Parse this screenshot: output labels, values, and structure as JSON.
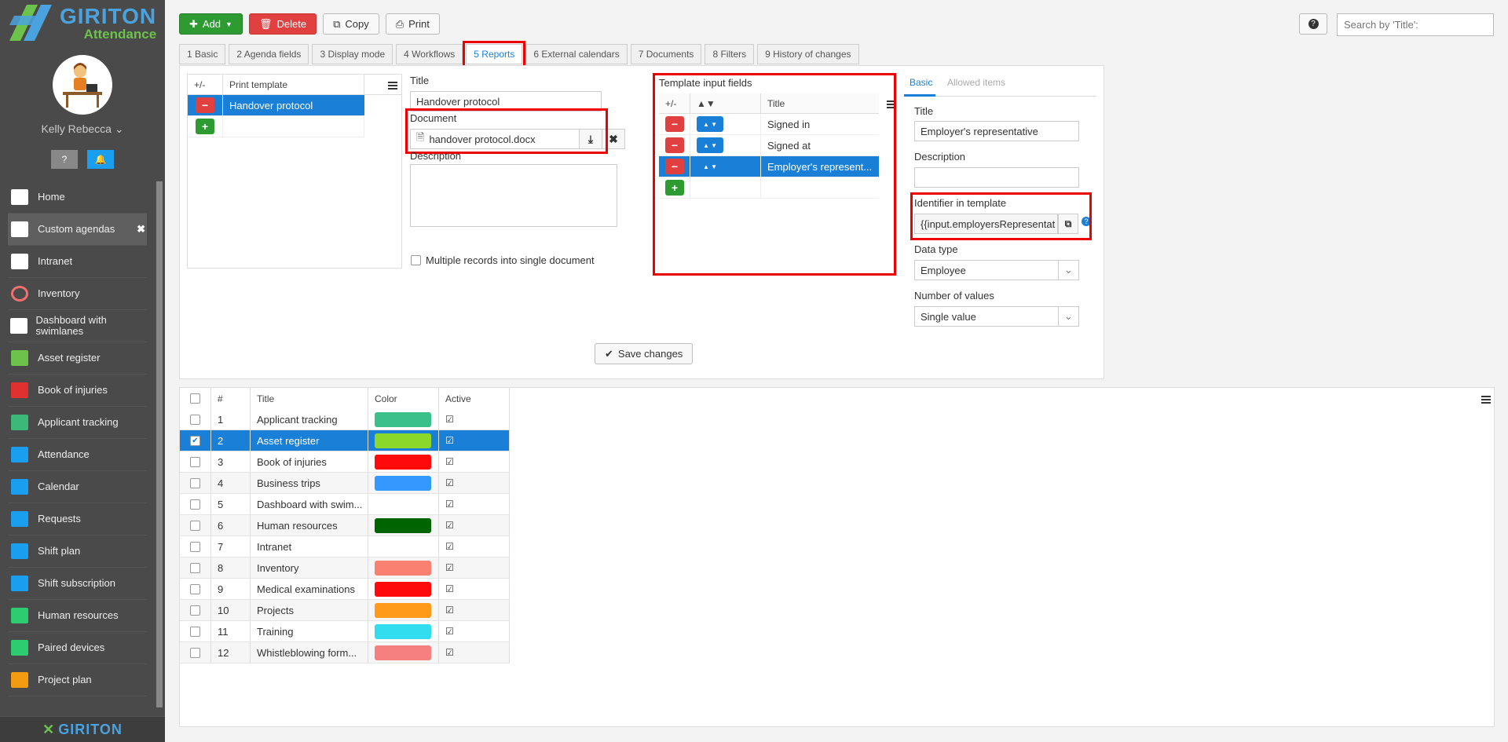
{
  "brand": {
    "name": "GIRITON",
    "product": "Attendance",
    "footer": "GIRITON"
  },
  "user": {
    "name": "Kelly Rebecca"
  },
  "sidebar": {
    "items": [
      {
        "label": "Home",
        "icon": "home-icon",
        "color": "#ffffff"
      },
      {
        "label": "Custom agendas",
        "icon": "list-icon",
        "color": "#ffffff",
        "active": true,
        "closable": "✖"
      },
      {
        "label": "Intranet",
        "icon": "institution-icon",
        "color": "#ffffff"
      },
      {
        "label": "Inventory",
        "icon": "circle-icon",
        "color": "#f07070"
      },
      {
        "label": "Dashboard with swimlanes",
        "icon": "columns-icon",
        "color": "#ffffff"
      },
      {
        "label": "Asset register",
        "icon": "archive-icon",
        "color": "#6cc24a"
      },
      {
        "label": "Book of injuries",
        "icon": "ambulance-icon",
        "color": "#e03030"
      },
      {
        "label": "Applicant tracking",
        "icon": "user-plus-icon",
        "color": "#3cb878"
      },
      {
        "label": "Attendance",
        "icon": "user-icon",
        "color": "#1a9ef0"
      },
      {
        "label": "Calendar",
        "icon": "calendar-icon",
        "color": "#1a9ef0"
      },
      {
        "label": "Requests",
        "icon": "gavel-icon",
        "color": "#1a9ef0"
      },
      {
        "label": "Shift plan",
        "icon": "calendar-grid-icon",
        "color": "#1a9ef0"
      },
      {
        "label": "Shift subscription",
        "icon": "calendar-check-icon",
        "color": "#1a9ef0"
      },
      {
        "label": "Human resources",
        "icon": "person-icon",
        "color": "#2ecc71"
      },
      {
        "label": "Paired devices",
        "icon": "mobile-icon",
        "color": "#2ecc71"
      },
      {
        "label": "Project plan",
        "icon": "calendar-orange-icon",
        "color": "#f39c12"
      }
    ]
  },
  "toolbar": {
    "add_label": "Add",
    "delete_label": "Delete",
    "copy_label": "Copy",
    "print_label": "Print",
    "help_label": "?",
    "search_placeholder": "Search by 'Title':"
  },
  "tabs": [
    {
      "label": "1 Basic"
    },
    {
      "label": "2 Agenda fields"
    },
    {
      "label": "3 Display mode"
    },
    {
      "label": "4 Workflows"
    },
    {
      "label": "5 Reports",
      "active": true
    },
    {
      "label": "6 External calendars"
    },
    {
      "label": "7 Documents"
    },
    {
      "label": "8 Filters"
    },
    {
      "label": "9 History of changes"
    }
  ],
  "templates": {
    "col_addremove": "+/-",
    "col_template": "Print template",
    "rows": [
      {
        "name": "Handover protocol"
      }
    ]
  },
  "form": {
    "title_label": "Title",
    "title_value": "Handover protocol",
    "document_label": "Document",
    "document_value": "handover protocol.docx",
    "description_label": "Description",
    "multi_label": "Multiple records into single document"
  },
  "inputs": {
    "heading": "Template input fields",
    "col_addremove": "+/-",
    "col_order": "▲▼",
    "col_title": "Title",
    "rows": [
      {
        "title": "Signed in"
      },
      {
        "title": "Signed at"
      },
      {
        "title": "Employer's represent..."
      }
    ]
  },
  "detail": {
    "tab_basic": "Basic",
    "tab_allowed": "Allowed items",
    "title_label": "Title",
    "title_value": "Employer's representative",
    "description_label": "Description",
    "identifier_label": "Identifier in template",
    "identifier_value": "{{input.employersRepresentat",
    "datatype_label": "Data type",
    "datatype_value": "Employee",
    "count_label": "Number of values",
    "count_value": "Single value"
  },
  "save_label": "Save changes",
  "list": {
    "col_num": "#",
    "col_title": "Title",
    "col_color": "Color",
    "col_active": "Active",
    "rows": [
      {
        "num": "1",
        "title": "Applicant tracking",
        "color": "#3cc08a",
        "selected": false
      },
      {
        "num": "2",
        "title": "Asset register",
        "color": "#8bd72a",
        "selected": true
      },
      {
        "num": "3",
        "title": "Book of injuries",
        "color": "#ff0a0a",
        "selected": false
      },
      {
        "num": "4",
        "title": "Business trips",
        "color": "#3399ff",
        "selected": false
      },
      {
        "num": "5",
        "title": "Dashboard with swim...",
        "color": "",
        "selected": false
      },
      {
        "num": "6",
        "title": "Human resources",
        "color": "#006400",
        "selected": false
      },
      {
        "num": "7",
        "title": "Intranet",
        "color": "",
        "selected": false
      },
      {
        "num": "8",
        "title": "Inventory",
        "color": "#fa8072",
        "selected": false
      },
      {
        "num": "9",
        "title": "Medical examinations",
        "color": "#ff0a0a",
        "selected": false
      },
      {
        "num": "10",
        "title": "Projects",
        "color": "#ff9a1a",
        "selected": false
      },
      {
        "num": "11",
        "title": "Training",
        "color": "#33ddf0",
        "selected": false
      },
      {
        "num": "12",
        "title": "Whistleblowing form...",
        "color": "#f58080",
        "selected": false
      }
    ]
  }
}
